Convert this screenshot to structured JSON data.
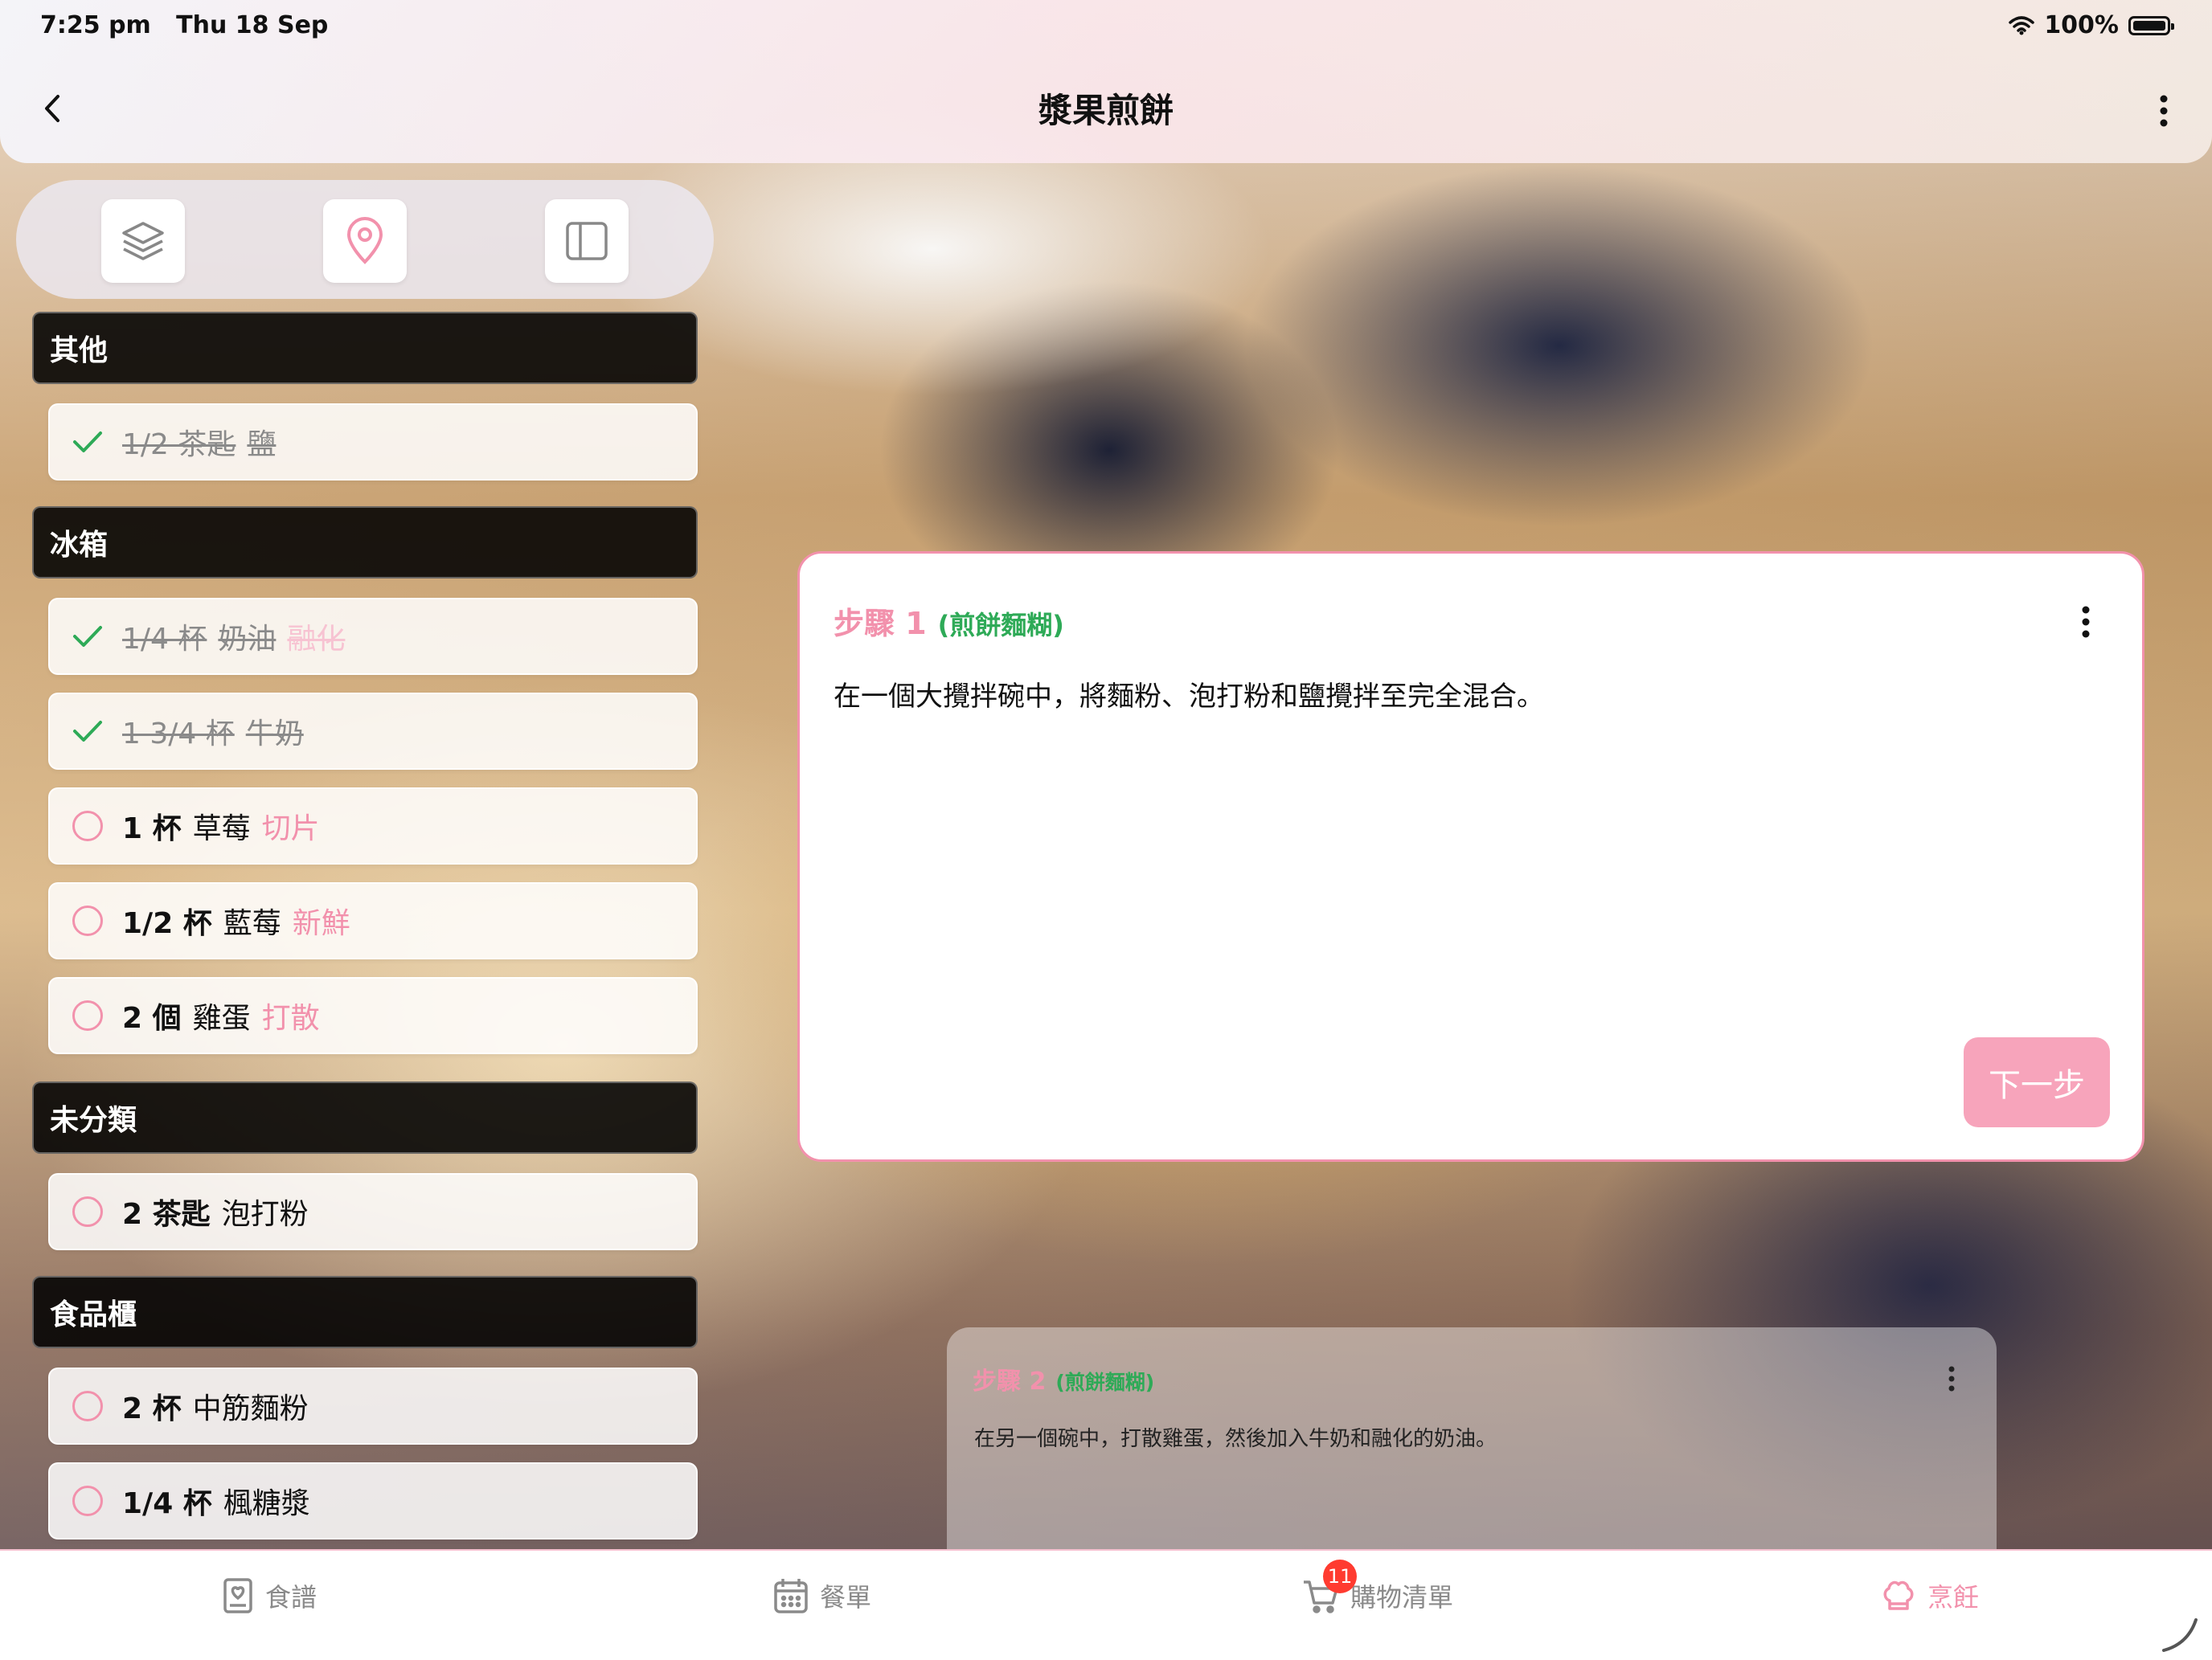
{
  "status_bar": {
    "time": "7:25 pm",
    "date": "Thu 18 Sep",
    "battery": "100%"
  },
  "nav": {
    "title": "漿果煎餅",
    "back_icon": "chevron-left-icon",
    "more_icon": "more-vertical-icon"
  },
  "toolbar": {
    "icons": [
      "layers-icon",
      "location-pin-icon",
      "sidebar-panel-icon"
    ]
  },
  "ingredient_categories": [
    {
      "name": "其他",
      "items": [
        {
          "qty": "1/2 茶匙",
          "name": "鹽",
          "note": "",
          "checked": true
        }
      ]
    },
    {
      "name": "冰箱",
      "items": [
        {
          "qty": "1/4 杯",
          "name": "奶油",
          "note": "融化",
          "checked": true
        },
        {
          "qty": "1 3/4 杯",
          "name": "牛奶",
          "note": "",
          "checked": true
        },
        {
          "qty": "1 杯",
          "name": "草莓",
          "note": "切片",
          "checked": false
        },
        {
          "qty": "1/2 杯",
          "name": "藍莓",
          "note": "新鮮",
          "checked": false
        },
        {
          "qty": "2 個",
          "name": "雞蛋",
          "note": "打散",
          "checked": false
        }
      ]
    },
    {
      "name": "未分類",
      "items": [
        {
          "qty": "2 茶匙",
          "name": "泡打粉",
          "note": "",
          "checked": false
        }
      ]
    },
    {
      "name": "食品櫃",
      "items": [
        {
          "qty": "2 杯",
          "name": "中筋麵粉",
          "note": "",
          "checked": false
        },
        {
          "qty": "1/4 杯",
          "name": "楓糖漿",
          "note": "",
          "checked": false
        }
      ]
    }
  ],
  "current_step": {
    "label": "步驟 1",
    "section": "(煎餅麵糊)",
    "text": "在一個大攪拌碗中，將麵粉、泡打粉和鹽攪拌至完全混合。",
    "next_label": "下一步"
  },
  "next_step": {
    "label": "步驟 2",
    "section": "(煎餅麵糊)",
    "text": "在另一個碗中，打散雞蛋，然後加入牛奶和融化的奶油。"
  },
  "tabs": [
    {
      "label": "食譜",
      "icon": "recipe-book-icon",
      "active": false
    },
    {
      "label": "餐單",
      "icon": "calendar-icon",
      "active": false
    },
    {
      "label": "購物清單",
      "icon": "cart-icon",
      "active": false,
      "badge": "11"
    },
    {
      "label": "烹飪",
      "icon": "chef-hat-icon",
      "active": true
    }
  ],
  "colors": {
    "accent_pink": "#f291ac",
    "section_green": "#2eaa57",
    "badge_red": "#ff3b30"
  }
}
